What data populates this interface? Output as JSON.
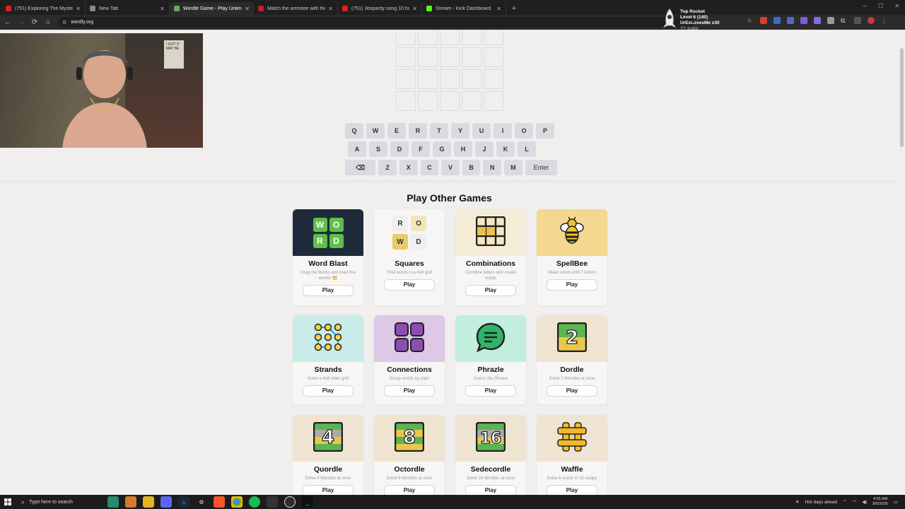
{
  "browser": {
    "tabs": [
      {
        "title": "(751) Exploring The Mystery Sp",
        "favicon_color": "#e02020",
        "active": false
      },
      {
        "title": "New Tab",
        "favicon_color": "#888888",
        "active": false
      },
      {
        "title": "Wordle Game - Play Unlimited",
        "favicon_color": "#6aaa64",
        "active": true
      },
      {
        "title": "Match the arrestee with their",
        "favicon_color": "#c81d25",
        "active": false
      },
      {
        "title": "(751) Jeopardy song 10 hours",
        "favicon_color": "#e02020",
        "active": false
      },
      {
        "title": "Stream - Kick Dashboard",
        "favicon_color": "#53fc18",
        "active": false
      }
    ],
    "new_tab_symbol": "+",
    "close_symbol": "✕",
    "url": "wordly.org"
  },
  "notification": {
    "line1": "Top Rocket",
    "line2": "Level 6  (140)",
    "line3": "UrExLovesMe x30",
    "line4": "?? Subs"
  },
  "webcam": {
    "poster_text": "I GOT IT MAY BE"
  },
  "keyboard": {
    "row1": [
      "Q",
      "W",
      "E",
      "R",
      "T",
      "Y",
      "U",
      "I",
      "O",
      "P"
    ],
    "row2": [
      "A",
      "S",
      "D",
      "F",
      "G",
      "H",
      "J",
      "K",
      "L"
    ],
    "row3": [
      "⌫",
      "Z",
      "X",
      "C",
      "V",
      "B",
      "N",
      "M",
      "Enter"
    ]
  },
  "section_title": "Play Other Games",
  "games": [
    {
      "name": "Word Blast",
      "desc": "Drag the blocks and blast the words! 💥",
      "play": "Play",
      "bg": "#1e2a3a",
      "icon": "word-blast-icon"
    },
    {
      "name": "Squares",
      "desc": "Find words in a 4x4 grid",
      "play": "Play",
      "bg": "#f7f6f4",
      "icon": "squares-icon"
    },
    {
      "name": "Combinations",
      "desc": "Combine letters and create words",
      "play": "Play",
      "bg": "#f5ecd8",
      "icon": "combinations-icon"
    },
    {
      "name": "SpellBee",
      "desc": "Make words with 7 letters",
      "play": "Play",
      "bg": "#f5d88f",
      "icon": "bee-icon"
    },
    {
      "name": "Strands",
      "desc": "Solve a 6x8 letter grid",
      "play": "Play",
      "bg": "#c9ece8",
      "icon": "strands-icon"
    },
    {
      "name": "Connections",
      "desc": "Group words by topic",
      "play": "Play",
      "bg": "#ddc8e6",
      "icon": "connections-icon"
    },
    {
      "name": "Phrazle",
      "desc": "Guess the Phrase",
      "play": "Play",
      "bg": "#c2eedd",
      "icon": "speech-bubble-icon"
    },
    {
      "name": "Dordle",
      "desc": "Solve 2 Wordles at once",
      "play": "Play",
      "bg": "#efe4d2",
      "icon": "dordle-icon"
    },
    {
      "name": "Quordle",
      "desc": "Solve 4 Wordles at once",
      "play": "Play",
      "bg": "#efe4d2",
      "icon": "quordle-icon"
    },
    {
      "name": "Octordle",
      "desc": "Solve 8 Wordles at once",
      "play": "Play",
      "bg": "#efe4d2",
      "icon": "octordle-icon"
    },
    {
      "name": "Sedecordle",
      "desc": "Solve 16 Wordles at once",
      "play": "Play",
      "bg": "#efe4d2",
      "icon": "sedecordle-icon"
    },
    {
      "name": "Waffle",
      "desc": "Solve 6 words in 15 swaps",
      "play": "Play",
      "bg": "#efe4d2",
      "icon": "waffle-icon"
    }
  ],
  "tile_labels": {
    "word_blast": [
      "W",
      "O",
      "R",
      "D"
    ],
    "squares": [
      "R",
      "O",
      "W",
      "D"
    ],
    "dordle": "2",
    "quordle": "4",
    "octordle": "8",
    "sedecordle": "16"
  },
  "taskbar": {
    "search_placeholder": "Type here to search",
    "weather": "Hot days ahead",
    "time": "4:55 AM",
    "date": "8/5/2025"
  },
  "colors": {
    "wordle_green": "#6aaa64",
    "wordle_yellow": "#c9b458",
    "key_bg": "#d9dbe0"
  }
}
